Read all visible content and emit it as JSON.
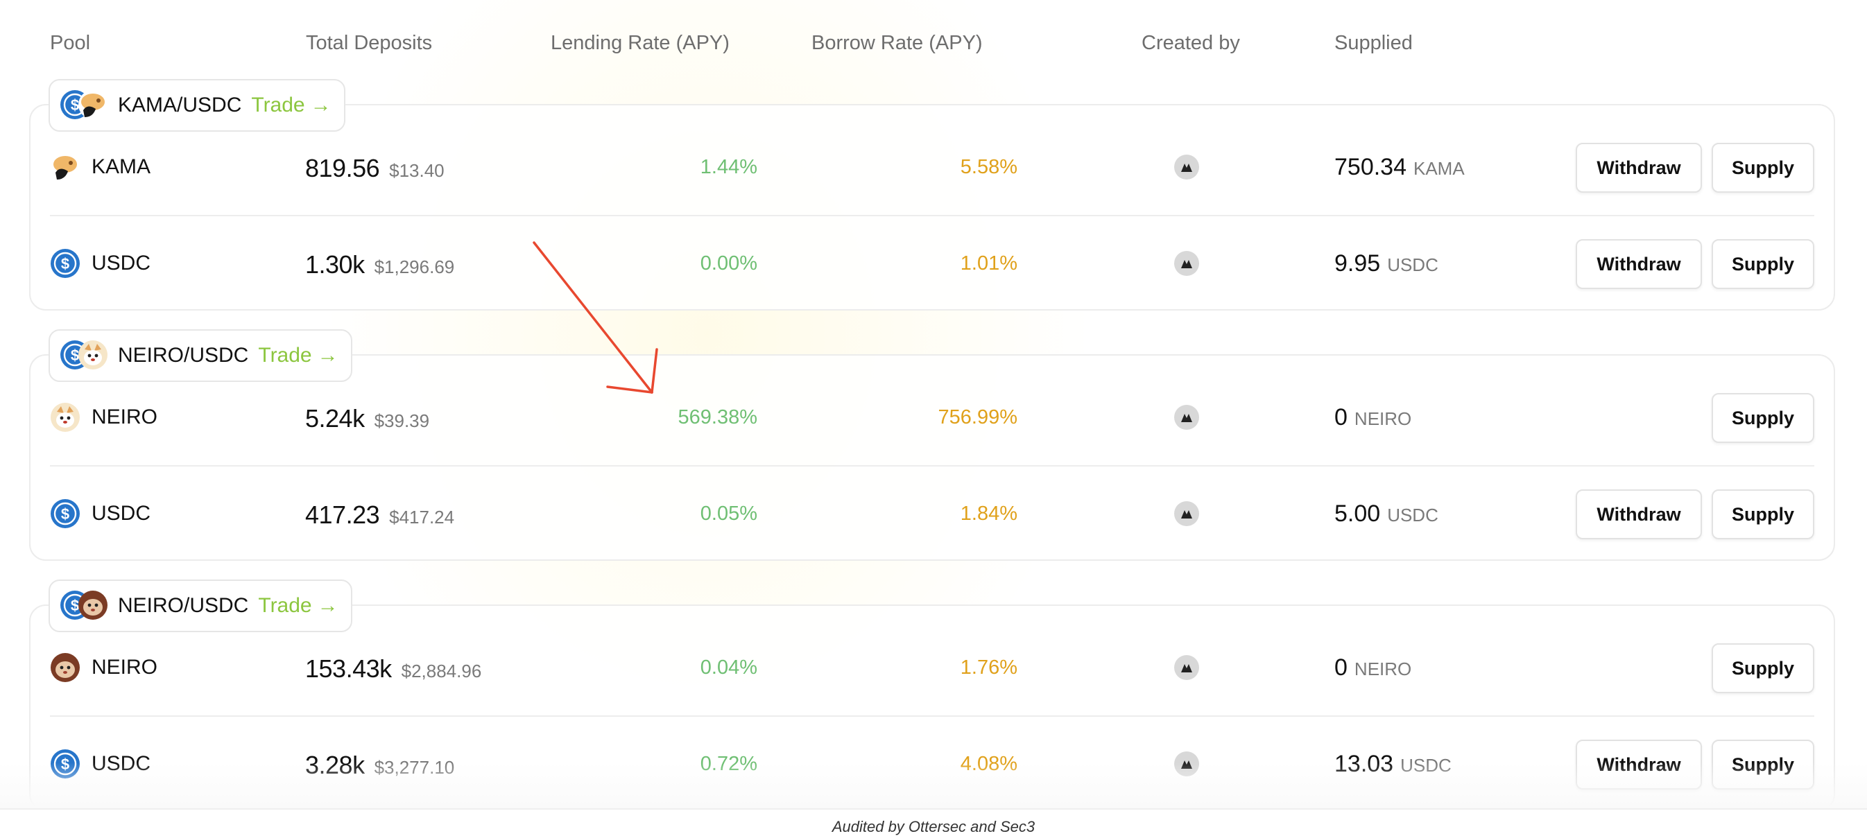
{
  "columns": {
    "pool": "Pool",
    "total_deposits": "Total Deposits",
    "lending_rate": "Lending Rate (APY)",
    "borrow_rate": "Borrow Rate (APY)",
    "created_by": "Created by",
    "supplied": "Supplied"
  },
  "pools": [
    {
      "name": "KAMA/USDC",
      "trade_label": "Trade",
      "assets": [
        {
          "name": "KAMA",
          "icon": "kama-token-icon",
          "deposits": "819.56",
          "deposits_usd": "$13.40",
          "lending": "1.44%",
          "borrow": "5.58%",
          "supplied": "750.34",
          "supplied_unit": "KAMA",
          "withdraw": "Withdraw",
          "supply": "Supply"
        },
        {
          "name": "USDC",
          "icon": "usdc-token-icon",
          "deposits": "1.30k",
          "deposits_usd": "$1,296.69",
          "lending": "0.00%",
          "borrow": "1.01%",
          "supplied": "9.95",
          "supplied_unit": "USDC",
          "withdraw": "Withdraw",
          "supply": "Supply"
        }
      ]
    },
    {
      "name": "NEIRO/USDC",
      "trade_label": "Trade",
      "assets": [
        {
          "name": "NEIRO",
          "icon": "neiro-token-icon",
          "deposits": "5.24k",
          "deposits_usd": "$39.39",
          "lending": "569.38%",
          "borrow": "756.99%",
          "supplied": "0",
          "supplied_unit": "NEIRO",
          "supply": "Supply"
        },
        {
          "name": "USDC",
          "icon": "usdc-token-icon",
          "deposits": "417.23",
          "deposits_usd": "$417.24",
          "lending": "0.05%",
          "borrow": "1.84%",
          "supplied": "5.00",
          "supplied_unit": "USDC",
          "withdraw": "Withdraw",
          "supply": "Supply"
        }
      ]
    },
    {
      "name": "NEIRO/USDC",
      "trade_label": "Trade",
      "assets": [
        {
          "name": "NEIRO",
          "icon": "neiro-token-icon",
          "deposits": "153.43k",
          "deposits_usd": "$2,884.96",
          "lending": "0.04%",
          "borrow": "1.76%",
          "supplied": "0",
          "supplied_unit": "NEIRO",
          "supply": "Supply"
        },
        {
          "name": "USDC",
          "icon": "usdc-token-icon",
          "deposits": "3.28k",
          "deposits_usd": "$3,277.10",
          "lending": "0.72%",
          "borrow": "4.08%",
          "supplied": "13.03",
          "supplied_unit": "USDC",
          "withdraw": "Withdraw",
          "supply": "Supply"
        }
      ]
    }
  ],
  "footer": {
    "audited": "Audited by Ottersec and Sec3"
  },
  "colors": {
    "lending": "#6fbf73",
    "borrow": "#e0a11b",
    "trade": "#8cc63f",
    "annotation_arrow": "#e8482f"
  }
}
